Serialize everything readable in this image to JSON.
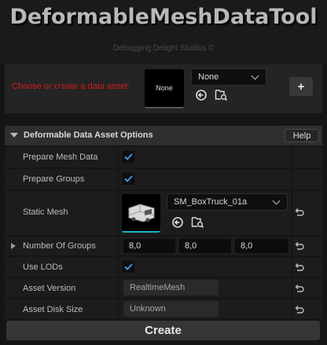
{
  "header": {
    "title": "DeformableMeshDataTool",
    "subtitle": "Debugging Delight Studios ©"
  },
  "asset_picker": {
    "label": "Choose or create a data asset:",
    "thumbnail_text": "None",
    "combo_value": "None",
    "add_label": "+",
    "label_color": "#d21c1c"
  },
  "section": {
    "title": "Deformable Data Asset Options",
    "help_label": "Help"
  },
  "rows": {
    "prepare_mesh_data": {
      "label": "Prepare Mesh Data",
      "checked": true
    },
    "prepare_groups": {
      "label": "Prepare Groups",
      "checked": true
    },
    "static_mesh": {
      "label": "Static Mesh",
      "value": "SM_BoxTruck_01a"
    },
    "number_of_groups": {
      "label": "Number Of Groups",
      "values": [
        "8,0",
        "8,0",
        "8,0"
      ]
    },
    "use_lods": {
      "label": "Use LODs",
      "checked": true
    },
    "asset_version": {
      "label": "Asset Version",
      "value": "RealtimeMesh"
    },
    "asset_disk_size": {
      "label": "Asset Disk Size",
      "value": "Unknown"
    }
  },
  "footer": {
    "create_label": "Create"
  },
  "icons": {
    "browse": "arrow-left-circle-icon",
    "find": "folder-search-icon",
    "reset": "reset-arrow-icon",
    "checkmark": "checkmark-icon"
  },
  "colors": {
    "check_color": "#3d8fe0",
    "accent_underline": "#1ab8c8"
  }
}
